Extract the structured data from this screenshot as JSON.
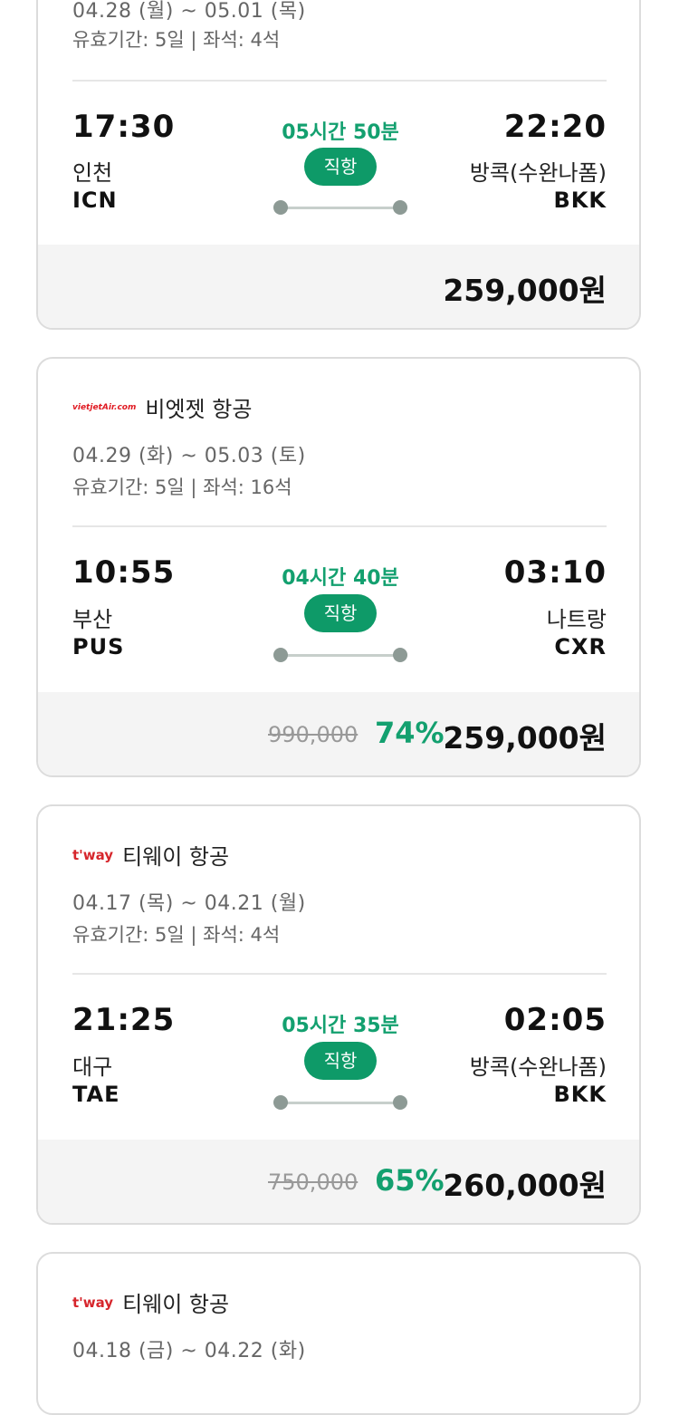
{
  "cards": [
    {
      "dates": "04.28 (월) ~ 05.01 (목)",
      "validity": "유효기간: 5일 | 좌석: 4석",
      "dep_time": "17:30",
      "dep_city": "인천",
      "dep_code": "ICN",
      "duration": "05시간 50분",
      "flight_type": "직항",
      "arr_time": "22:20",
      "arr_city": "방콕(수완나폼)",
      "arr_code": "BKK",
      "price": "259,000원"
    },
    {
      "airline_logo": "vietjetAir.com",
      "airline": "비엣젯 항공",
      "dates": "04.29 (화) ~ 05.03 (토)",
      "validity": "유효기간: 5일 | 좌석: 16석",
      "dep_time": "10:55",
      "dep_city": "부산",
      "dep_code": "PUS",
      "duration": "04시간 40분",
      "flight_type": "직항",
      "arr_time": "03:10",
      "arr_city": "나트랑",
      "arr_code": "CXR",
      "original_price": "990,000",
      "discount": "74%",
      "price": "259,000원"
    },
    {
      "airline_logo": "t'way",
      "airline": "티웨이 항공",
      "dates": "04.17 (목) ~ 04.21 (월)",
      "validity": "유효기간: 5일 | 좌석: 4석",
      "dep_time": "21:25",
      "dep_city": "대구",
      "dep_code": "TAE",
      "duration": "05시간 35분",
      "flight_type": "직항",
      "arr_time": "02:05",
      "arr_city": "방콕(수완나폼)",
      "arr_code": "BKK",
      "original_price": "750,000",
      "discount": "65%",
      "price": "260,000원"
    },
    {
      "airline_logo": "t'way",
      "airline": "티웨이 항공",
      "dates": "04.18 (금) ~ 04.22 (화)"
    }
  ],
  "colors": {
    "accent": "#13a06f",
    "pill": "#0e9a68",
    "vietjet": "#e01a22",
    "tway": "#d6262c"
  }
}
